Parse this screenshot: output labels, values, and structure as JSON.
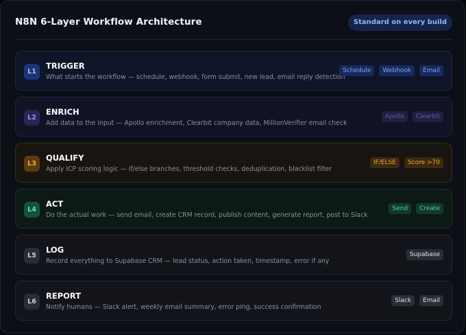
{
  "header": {
    "title": "N8N 6-Layer Workflow Architecture",
    "badge": "Standard on every build"
  },
  "layers": [
    {
      "code": "L1",
      "name": "TRIGGER",
      "description": "What starts the workflow — schedule, webhook, form submit, new lead, email reply detection",
      "tags": [
        "Schedule",
        "Webhook",
        "Email"
      ],
      "colors": {
        "bg": "#0e1528",
        "border": "#1d2848",
        "num_bg": "#1d3574",
        "num_fg": "#9fbcff",
        "tag_bg": "#172a58",
        "tag_fg": "#7aa2ff"
      }
    },
    {
      "code": "L2",
      "name": "ENRICH",
      "description": "Add data to the input — Apollo enrichment, Clearbit company data, MillionVerifier email check",
      "tags": [
        "Apollo",
        "Clearbit"
      ],
      "colors": {
        "bg": "#111224",
        "border": "#22233c",
        "num_bg": "#2a2555",
        "num_fg": "#9c93e0",
        "tag_bg": "#221f42",
        "tag_fg": "#625d92"
      }
    },
    {
      "code": "L3",
      "name": "QUALIFY",
      "description": "Apply ICP scoring logic — if/else branches, threshold checks, deduplication, blacklist filter",
      "tags": [
        "IF/ELSE",
        "Score >70"
      ],
      "colors": {
        "bg": "#181510",
        "border": "#3a2d16",
        "num_bg": "#5a3c10",
        "num_fg": "#f0a83a",
        "tag_bg": "#3a2a10",
        "tag_fg": "#f0a83a"
      }
    },
    {
      "code": "L4",
      "name": "ACT",
      "description": "Do the actual work — send email, create CRM record, publish content, generate report, post to Slack",
      "tags": [
        "Send",
        "Create"
      ],
      "colors": {
        "bg": "#0d1915",
        "border": "#173328",
        "num_bg": "#145238",
        "num_fg": "#5fe3a5",
        "tag_bg": "#123a2b",
        "tag_fg": "#4cd994"
      }
    },
    {
      "code": "L5",
      "name": "LOG",
      "description": "Record everything to Supabase CRM — lead status, action taken, timestamp, error if any",
      "tags": [
        "Supabase"
      ],
      "colors": {
        "bg": "#12141a",
        "border": "#252830",
        "num_bg": "#2a2d35",
        "num_fg": "#c9cdd5",
        "tag_bg": "#2a2d35",
        "tag_fg": "#dfe2e8"
      }
    },
    {
      "code": "L6",
      "name": "REPORT",
      "description": "Notify humans — Slack alert, weekly email summary, error ping, success confirmation",
      "tags": [
        "Slack",
        "Email"
      ],
      "colors": {
        "bg": "#12141a",
        "border": "#252830",
        "num_bg": "#2a2d35",
        "num_fg": "#c9cdd5",
        "tag_bg": "#2a2d35",
        "tag_fg": "#dfe2e8"
      }
    }
  ]
}
